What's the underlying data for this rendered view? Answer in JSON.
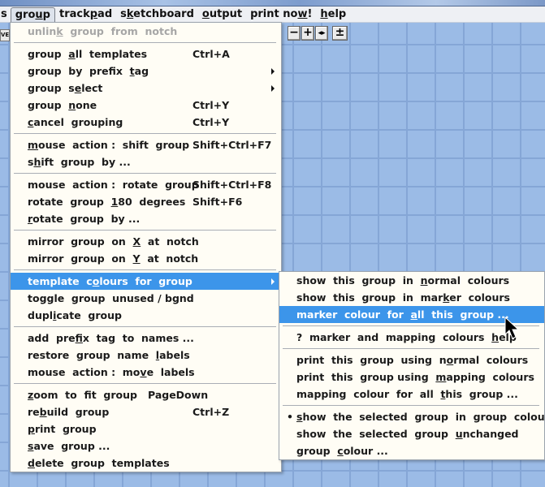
{
  "menubar": {
    "items": [
      {
        "label_pre": "s",
        "label_u": "",
        "label_post": ""
      },
      {
        "label_pre": "gro",
        "label_u": "u",
        "label_post": "p",
        "open": true
      },
      {
        "label_pre": "track",
        "label_u": "p",
        "label_post": "ad"
      },
      {
        "label_pre": "s",
        "label_u": "k",
        "label_post": "etchboard"
      },
      {
        "label_pre": "",
        "label_u": "o",
        "label_post": "utput"
      },
      {
        "label_pre": "print no",
        "label_u": "w",
        "label_post": "!"
      },
      {
        "label_pre": "",
        "label_u": "h",
        "label_post": "elp"
      }
    ]
  },
  "toolbar": {
    "left_button": "VE",
    "zoom_out": "−",
    "zoom_in": "+",
    "fit_width": "◂▸",
    "plus_minus": "±"
  },
  "group_menu": {
    "items": [
      {
        "type": "item",
        "pre": "unlin",
        "u": "k",
        "post": "  group  from  notch",
        "disabled": true
      },
      {
        "type": "sep"
      },
      {
        "type": "item",
        "pre": "group  ",
        "u": "a",
        "post": "ll  templates",
        "shortcut": "Ctrl+A"
      },
      {
        "type": "item",
        "pre": "group  by  prefix  ",
        "u": "t",
        "post": "ag",
        "submenu": true
      },
      {
        "type": "item",
        "pre": "group  s",
        "u": "e",
        "post": "lect",
        "submenu": true
      },
      {
        "type": "item",
        "pre": "group  ",
        "u": "n",
        "post": "one",
        "shortcut": "Ctrl+Y"
      },
      {
        "type": "item",
        "pre": "",
        "u": "c",
        "post": "ancel  grouping",
        "shortcut": "Ctrl+Y"
      },
      {
        "type": "sep"
      },
      {
        "type": "item",
        "pre": "",
        "u": "m",
        "post": "ouse  action :  shift  group",
        "shortcut": "Shift+Ctrl+F7"
      },
      {
        "type": "item",
        "pre": "s",
        "u": "h",
        "post": "ift  group  by ...",
        "shortcut": ""
      },
      {
        "type": "sep"
      },
      {
        "type": "item",
        "pre": "mouse  action :  rotate  group",
        "u": "",
        "post": "",
        "shortcut": "Shift+Ctrl+F8"
      },
      {
        "type": "item",
        "pre": "rotate  group  ",
        "u": "1",
        "post": "80  degrees",
        "shortcut": "Shift+F6"
      },
      {
        "type": "item",
        "pre": "",
        "u": "r",
        "post": "otate  group  by ..."
      },
      {
        "type": "sep"
      },
      {
        "type": "item",
        "pre": "mirror  group  on  ",
        "u": "X",
        "post": "  at  notch"
      },
      {
        "type": "item",
        "pre": "mirror  group  on  ",
        "u": "Y",
        "post": "  at  notch"
      },
      {
        "type": "sep"
      },
      {
        "type": "item",
        "pre": "template  c",
        "u": "o",
        "post": "lours  for  group",
        "submenu": true,
        "highlighted": true
      },
      {
        "type": "item",
        "pre": "toggle  group  unused / bgnd",
        "u": "",
        "post": ""
      },
      {
        "type": "item",
        "pre": "dupl",
        "u": "i",
        "post": "cate  group"
      },
      {
        "type": "sep"
      },
      {
        "type": "item",
        "pre": "add  pre",
        "u": "f",
        "post": "ix  tag  to  names ..."
      },
      {
        "type": "item",
        "pre": "restore  group  name  ",
        "u": "l",
        "post": "abels"
      },
      {
        "type": "item",
        "pre": "mouse  action :  mo",
        "u": "v",
        "post": "e  labels"
      },
      {
        "type": "sep"
      },
      {
        "type": "item",
        "pre": "",
        "u": "z",
        "post": "oom  to  fit  group   PageDown"
      },
      {
        "type": "item",
        "pre": "re",
        "u": "b",
        "post": "uild  group",
        "shortcut": "Ctrl+Z"
      },
      {
        "type": "item",
        "pre": "",
        "u": "p",
        "post": "rint  group"
      },
      {
        "type": "item",
        "pre": "",
        "u": "s",
        "post": "ave  group ..."
      },
      {
        "type": "item",
        "pre": "",
        "u": "d",
        "post": "elete  group  templates"
      }
    ]
  },
  "colours_submenu": {
    "items": [
      {
        "type": "item",
        "pre": "show  this  group  in  ",
        "u": "n",
        "post": "ormal  colours"
      },
      {
        "type": "item",
        "pre": "show  this  group  in  mar",
        "u": "k",
        "post": "er  colours"
      },
      {
        "type": "item",
        "pre": "marker  colour  for  ",
        "u": "a",
        "post": "ll  this  group ...",
        "highlighted": true
      },
      {
        "type": "sep"
      },
      {
        "type": "item",
        "pre": "?  marker  and  mapping  colours  ",
        "u": "h",
        "post": "elp"
      },
      {
        "type": "sep"
      },
      {
        "type": "item",
        "pre": "print  this  group  using  n",
        "u": "o",
        "post": "rmal  colours"
      },
      {
        "type": "item",
        "pre": "print  this  group using  ",
        "u": "m",
        "post": "apping  colours"
      },
      {
        "type": "item",
        "pre": "mapping  colour  for  all  ",
        "u": "t",
        "post": "his  group ..."
      },
      {
        "type": "sep"
      },
      {
        "type": "item",
        "pre": "",
        "u": "s",
        "post": "how  the  selected  group  in  group  colour",
        "checked": true
      },
      {
        "type": "item",
        "pre": "show  the  selected  group  ",
        "u": "u",
        "post": "nchanged"
      },
      {
        "type": "item",
        "pre": "group  ",
        "u": "c",
        "post": "olour ..."
      }
    ]
  },
  "cursor": {
    "icon": "arrow-pointer-icon"
  }
}
